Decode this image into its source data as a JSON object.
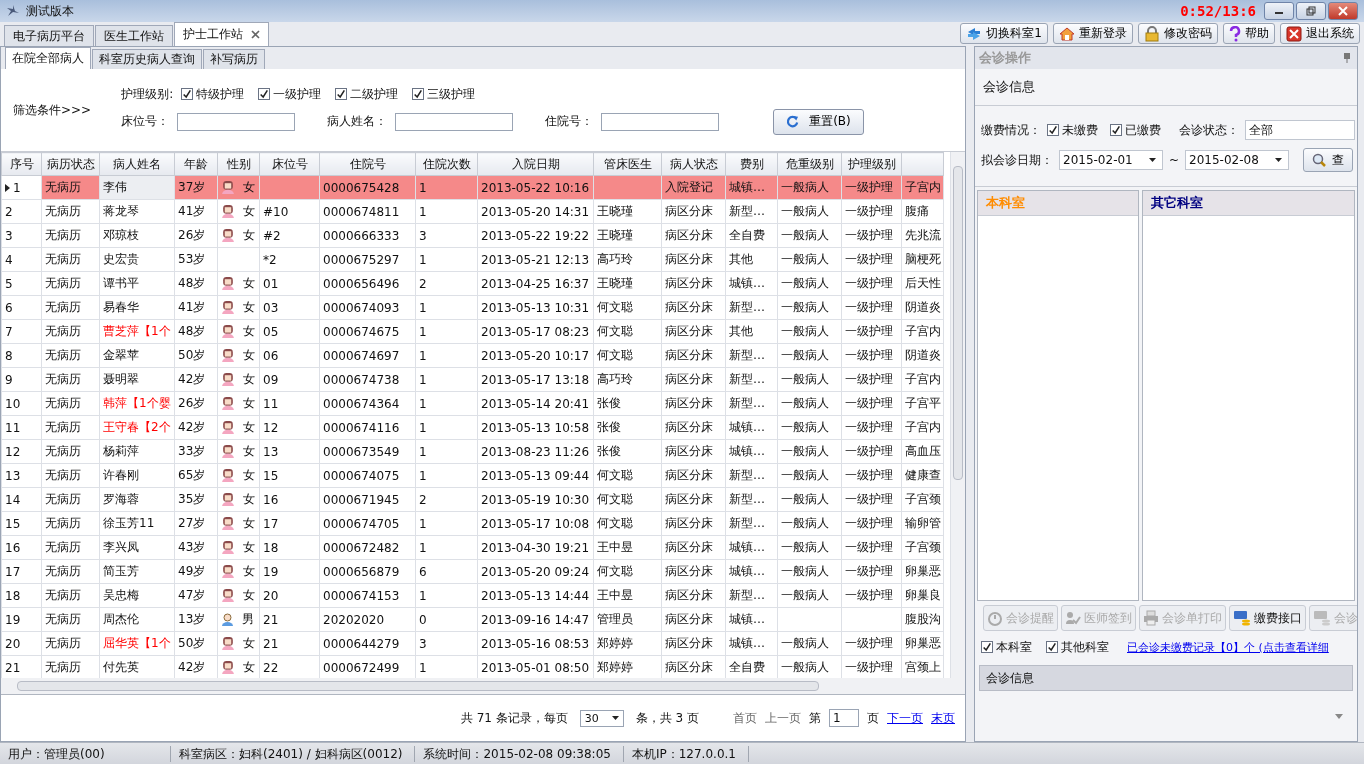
{
  "window": {
    "title": "测试版本",
    "recording_timer": "0:52/13:6"
  },
  "main_tabs": [
    {
      "label": "电子病历平台",
      "selected": false
    },
    {
      "label": "医生工作站",
      "selected": false
    },
    {
      "label": "护士工作站",
      "selected": true,
      "closable": true
    }
  ],
  "toolbar": [
    {
      "label": "切换科室1",
      "kind": "switch"
    },
    {
      "label": "重新登录",
      "kind": "home"
    },
    {
      "label": "修改密码",
      "kind": "lock"
    },
    {
      "label": "帮助",
      "kind": "help"
    },
    {
      "label": "退出系统",
      "kind": "exit"
    }
  ],
  "sub_tabs": [
    {
      "label": "在院全部病人",
      "selected": true
    },
    {
      "label": "科室历史病人查询",
      "selected": false
    },
    {
      "label": "补写病历",
      "selected": false
    }
  ],
  "filter": {
    "title": "筛选条件>>>",
    "nursing_label": "护理级别:",
    "nursing_levels": [
      {
        "label": "特级护理",
        "checked": true
      },
      {
        "label": "一级护理",
        "checked": true
      },
      {
        "label": "二级护理",
        "checked": true
      },
      {
        "label": "三级护理",
        "checked": true
      }
    ],
    "fields": [
      {
        "label": "床位号："
      },
      {
        "label": "病人姓名："
      },
      {
        "label": "住院号："
      }
    ],
    "reset_button": "重置(B)"
  },
  "table": {
    "columns": [
      "序号",
      "病历状态",
      "病人姓名",
      "年龄",
      "性别",
      "床位号",
      "住院号",
      "住院次数",
      "入院日期",
      "管床医生",
      "病人状态",
      "费别",
      "危重级别",
      "护理级别"
    ],
    "rows": [
      {
        "selected": true,
        "alert": false,
        "no": "1",
        "record": "无病历",
        "name": "李伟",
        "age": "37岁",
        "kind": "female",
        "gender": "女",
        "inpatient_no": "0000675428",
        "visits": "1",
        "admitted": "2013-05-22 10:16",
        "status": "入院登记",
        "fee": "城镇…",
        "severity": "一般病人",
        "nursing": "一级护理",
        "column_15": "子宫内"
      },
      {
        "selected": false,
        "alert": false,
        "no": "2",
        "record": "无病历",
        "name": "蒋龙琴",
        "age": "41岁",
        "kind": "female",
        "gender": "女",
        "bed": "#10",
        "inpatient_no": "0000674811",
        "visits": "1",
        "admitted": "2013-05-20 14:31",
        "doctor": "王晓瑾",
        "status": "病区分床",
        "fee": "新型…",
        "severity": "一般病人",
        "nursing": "一级护理",
        "column_15": "腹痛"
      },
      {
        "selected": false,
        "alert": false,
        "no": "3",
        "record": "无病历",
        "name": "邓琼枝",
        "age": "26岁",
        "kind": "female",
        "gender": "女",
        "bed": "#2",
        "inpatient_no": "0000666333",
        "visits": "3",
        "admitted": "2013-05-22 19:22",
        "doctor": "王晓瑾",
        "status": "病区分床",
        "fee": "全自费",
        "severity": "一般病人",
        "nursing": "一级护理",
        "column_15": "先兆流"
      },
      {
        "selected": false,
        "alert": false,
        "no": "4",
        "record": "无病历",
        "name": "史宏贵",
        "age": "53岁",
        "bed": "*2",
        "inpatient_no": "0000675297",
        "visits": "1",
        "admitted": "2013-05-21 12:13",
        "doctor": "高巧玲",
        "status": "病区分床",
        "fee": "其他",
        "severity": "一般病人",
        "nursing": "一级护理",
        "column_15": "脑梗死"
      },
      {
        "selected": false,
        "alert": false,
        "no": "5",
        "record": "无病历",
        "name": "谭书平",
        "age": "48岁",
        "kind": "female",
        "gender": "女",
        "bed": "01",
        "inpatient_no": "0000656496",
        "visits": "2",
        "admitted": "2013-04-25 16:37",
        "doctor": "王晓瑾",
        "status": "病区分床",
        "fee": "城镇…",
        "severity": "一般病人",
        "nursing": "一级护理",
        "column_15": "后天性"
      },
      {
        "selected": false,
        "alert": false,
        "no": "6",
        "record": "无病历",
        "name": "易春华",
        "age": "41岁",
        "kind": "female",
        "gender": "女",
        "bed": "03",
        "inpatient_no": "0000674093",
        "visits": "1",
        "admitted": "2013-05-13 10:31",
        "doctor": "何文聪",
        "status": "病区分床",
        "fee": "新型…",
        "severity": "一般病人",
        "nursing": "一级护理",
        "column_15": "阴道炎"
      },
      {
        "selected": false,
        "alert": true,
        "no": "7",
        "record": "无病历",
        "name": "曹芝萍【1个",
        "age": "48岁",
        "kind": "female",
        "gender": "女",
        "bed": "05",
        "inpatient_no": "0000674675",
        "visits": "1",
        "admitted": "2013-05-17 08:23",
        "doctor": "何文聪",
        "status": "病区分床",
        "fee": "其他",
        "severity": "一般病人",
        "nursing": "一级护理",
        "column_15": "子宫内"
      },
      {
        "selected": false,
        "alert": false,
        "no": "8",
        "record": "无病历",
        "name": "金翠苹",
        "age": "50岁",
        "kind": "female",
        "gender": "女",
        "bed": "06",
        "inpatient_no": "0000674697",
        "visits": "1",
        "admitted": "2013-05-20 10:17",
        "doctor": "何文聪",
        "status": "病区分床",
        "fee": "新型…",
        "severity": "一般病人",
        "nursing": "一级护理",
        "column_15": "阴道炎"
      },
      {
        "selected": false,
        "alert": false,
        "no": "9",
        "record": "无病历",
        "name": "聂明翠",
        "age": "42岁",
        "kind": "female",
        "gender": "女",
        "bed": "09",
        "inpatient_no": "0000674738",
        "visits": "1",
        "admitted": "2013-05-17 13:18",
        "doctor": "高巧玲",
        "status": "病区分床",
        "fee": "新型…",
        "severity": "一般病人",
        "nursing": "一级护理",
        "column_15": "子宫内"
      },
      {
        "selected": false,
        "alert": true,
        "no": "10",
        "record": "无病历",
        "name": "韩萍【1个婴",
        "age": "26岁",
        "kind": "female",
        "gender": "女",
        "bed": "11",
        "inpatient_no": "0000674364",
        "visits": "1",
        "admitted": "2013-05-14 20:41",
        "doctor": "张俊",
        "status": "病区分床",
        "fee": "新型…",
        "severity": "一般病人",
        "nursing": "一级护理",
        "column_15": "子宫平"
      },
      {
        "selected": false,
        "alert": true,
        "no": "11",
        "record": "无病历",
        "name": "王守春【2个",
        "age": "42岁",
        "kind": "female",
        "gender": "女",
        "bed": "12",
        "inpatient_no": "0000674116",
        "visits": "1",
        "admitted": "2013-05-13 10:58",
        "doctor": "张俊",
        "status": "病区分床",
        "fee": "城镇…",
        "severity": "一般病人",
        "nursing": "一级护理",
        "column_15": "子宫内"
      },
      {
        "selected": false,
        "alert": false,
        "no": "12",
        "record": "无病历",
        "name": "杨莉萍",
        "age": "33岁",
        "kind": "female",
        "gender": "女",
        "bed": "13",
        "inpatient_no": "0000673549",
        "visits": "1",
        "admitted": "2013-08-23 11:26",
        "doctor": "张俊",
        "status": "病区分床",
        "fee": "城镇…",
        "severity": "一般病人",
        "nursing": "一级护理",
        "column_15": "高血压"
      },
      {
        "selected": false,
        "alert": false,
        "no": "13",
        "record": "无病历",
        "name": "许春刚",
        "age": "65岁",
        "kind": "female",
        "gender": "女",
        "bed": "15",
        "inpatient_no": "0000674075",
        "visits": "1",
        "admitted": "2013-05-13 09:44",
        "doctor": "何文聪",
        "status": "病区分床",
        "fee": "新型…",
        "severity": "一般病人",
        "nursing": "一级护理",
        "column_15": "健康查"
      },
      {
        "selected": false,
        "alert": false,
        "no": "14",
        "record": "无病历",
        "name": "罗海蓉",
        "age": "35岁",
        "kind": "female",
        "gender": "女",
        "bed": "16",
        "inpatient_no": "0000671945",
        "visits": "2",
        "admitted": "2013-05-19 10:30",
        "doctor": "何文聪",
        "status": "病区分床",
        "fee": "新型…",
        "severity": "一般病人",
        "nursing": "一级护理",
        "column_15": "子宫颈"
      },
      {
        "selected": false,
        "alert": false,
        "no": "15",
        "record": "无病历",
        "name": "徐玉芳11",
        "age": "27岁",
        "kind": "female",
        "gender": "女",
        "bed": "17",
        "inpatient_no": "0000674705",
        "visits": "1",
        "admitted": "2013-05-17 10:08",
        "doctor": "何文聪",
        "status": "病区分床",
        "fee": "新型…",
        "severity": "一般病人",
        "nursing": "一级护理",
        "column_15": "输卵管"
      },
      {
        "selected": false,
        "alert": false,
        "no": "16",
        "record": "无病历",
        "name": "李兴凤",
        "age": "43岁",
        "kind": "female",
        "gender": "女",
        "bed": "18",
        "inpatient_no": "0000672482",
        "visits": "1",
        "admitted": "2013-04-30 19:21",
        "doctor": "王中昱",
        "status": "病区分床",
        "fee": "城镇…",
        "severity": "一般病人",
        "nursing": "一级护理",
        "column_15": "子宫颈"
      },
      {
        "selected": false,
        "alert": false,
        "no": "17",
        "record": "无病历",
        "name": "简玉芳",
        "age": "49岁",
        "kind": "female",
        "gender": "女",
        "bed": "19",
        "inpatient_no": "0000656879",
        "visits": "6",
        "admitted": "2013-05-20 09:24",
        "doctor": "何文聪",
        "status": "病区分床",
        "fee": "城镇…",
        "severity": "一般病人",
        "nursing": "一级护理",
        "column_15": "卵巢恶"
      },
      {
        "selected": false,
        "alert": false,
        "no": "18",
        "record": "无病历",
        "name": "吴忠梅",
        "age": "47岁",
        "kind": "female",
        "gender": "女",
        "bed": "20",
        "inpatient_no": "0000674153",
        "visits": "1",
        "admitted": "2013-05-13 14:44",
        "doctor": "王中昱",
        "status": "病区分床",
        "fee": "新型…",
        "severity": "一般病人",
        "nursing": "一级护理",
        "column_15": "卵巢良"
      },
      {
        "selected": false,
        "alert": false,
        "no": "19",
        "record": "无病历",
        "name": "周杰伦",
        "age": "13岁",
        "kind": "male",
        "gender": "男",
        "bed": "21",
        "inpatient_no": "20202020",
        "visits": "0",
        "admitted": "2013-09-16 14:47",
        "doctor": "管理员",
        "status": "病区分床",
        "fee": "城镇…",
        "column_15": "腹股沟"
      },
      {
        "selected": false,
        "alert": true,
        "no": "20",
        "record": "无病历",
        "name": "屈华英【1个",
        "age": "50岁",
        "kind": "female",
        "gender": "女",
        "bed": "21",
        "inpatient_no": "0000644279",
        "visits": "3",
        "admitted": "2013-05-16 08:53",
        "doctor": "郑婷婷",
        "status": "病区分床",
        "fee": "城镇…",
        "severity": "一般病人",
        "nursing": "一级护理",
        "column_15": "卵巢恶"
      },
      {
        "selected": false,
        "alert": false,
        "no": "21",
        "record": "无病历",
        "name": "付先英",
        "age": "42岁",
        "kind": "female",
        "gender": "女",
        "bed": "22",
        "inpatient_no": "0000672499",
        "visits": "1",
        "admitted": "2013-05-01 08:50",
        "doctor": "郑婷婷",
        "status": "病区分床",
        "fee": "全自费",
        "severity": "一般病人",
        "nursing": "一级护理",
        "column_15": "宫颈上"
      }
    ]
  },
  "pagination": {
    "summary": "共 71 条记录，每页",
    "page_size": "30",
    "pages_text": "条，共 3 页",
    "first": "首页",
    "prev": "上一页",
    "page_label": "第",
    "page": "1",
    "page_suffix": "页",
    "next": "下一页",
    "last": "末页"
  },
  "consult_panel": {
    "title": "会诊操作",
    "ribbon": "会诊信息",
    "payment_label": "缴费情况：",
    "payment": [
      {
        "label": "未缴费",
        "checked": true
      },
      {
        "label": "已缴费",
        "checked": true
      }
    ],
    "status_label": "会诊状态：",
    "status_value": "全部",
    "date_label": "拟会诊日期：",
    "date_from": "2015-02-01",
    "date_sep": "~",
    "date_to": "2015-02-08",
    "query_button": "查",
    "lists": [
      {
        "title": "本科室",
        "color": "#ff8c00"
      },
      {
        "title": "其它科室",
        "color": "#000080"
      }
    ],
    "actions": [
      {
        "label": "会诊提醒",
        "kind": "alarm",
        "disabled": true
      },
      {
        "label": "医师签到",
        "kind": "signin",
        "disabled": true
      },
      {
        "label": "会诊单打印",
        "kind": "print",
        "disabled": true
      },
      {
        "label": "缴费接口",
        "kind": "pay",
        "disabled": false
      },
      {
        "label": "会诊",
        "kind": "pay",
        "disabled": true
      }
    ],
    "scope": [
      {
        "label": "本科室",
        "checked": true
      },
      {
        "label": "其他科室",
        "checked": true
      }
    ],
    "unpaid_link": "已会诊未缴费记录【0】个 (点击查看详细",
    "info_bar": "会诊信息"
  },
  "status_bar": [
    "用户：管理员(00)",
    "科室病区：妇科(2401) / 妇科病区(0012)",
    "系统时间：2015-02-08 09:38:05",
    "本机IP：127.0.0.1"
  ]
}
